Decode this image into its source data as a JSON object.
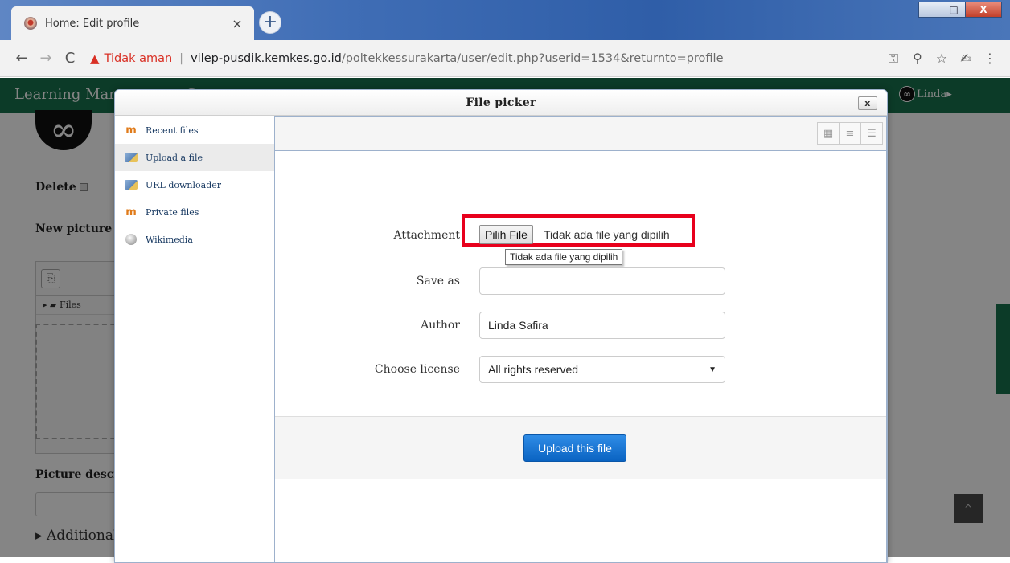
{
  "browser": {
    "tab_title": "Home: Edit profile",
    "tab_close": "×",
    "new_tab": "+",
    "security_label": "Tidak aman",
    "url_host": "vilep-pusdik.kemkes.go.id",
    "url_path": "/poltekkessurakarta/user/edit.php?userid=1534&returnto=profile",
    "window_buttons": [
      "—",
      "□",
      "X"
    ]
  },
  "page": {
    "brand": "Learning Management System",
    "user_name": "Linda",
    "delete_label": "Delete",
    "new_picture_label": "New picture",
    "files_label": "Files",
    "picture_description_label": "Picture description",
    "additional_label": "Additional names"
  },
  "dialog": {
    "title": "File picker",
    "close_label": "x",
    "repositories": [
      {
        "label": "Recent files",
        "icon": "moodle-icon"
      },
      {
        "label": "Upload a file",
        "icon": "upload-icon"
      },
      {
        "label": "URL downloader",
        "icon": "url-icon"
      },
      {
        "label": "Private files",
        "icon": "moodle-icon"
      },
      {
        "label": "Wikimedia",
        "icon": "wikimedia-icon"
      }
    ],
    "active_repository": "Upload a file",
    "form": {
      "attachment_label": "Attachment",
      "choose_file_button": "Pilih File",
      "no_file_text": "Tidak ada file yang dipilih",
      "tooltip": "Tidak ada file yang dipilih",
      "save_as_label": "Save as",
      "save_as_value": "",
      "author_label": "Author",
      "author_value": "Linda Safira",
      "license_label": "Choose license",
      "license_value": "All rights reserved"
    },
    "upload_button": "Upload this file"
  },
  "colors": {
    "navbar_green": "#17724d",
    "highlight_red": "#e8001c",
    "primary_blue": "#0a63c2"
  }
}
